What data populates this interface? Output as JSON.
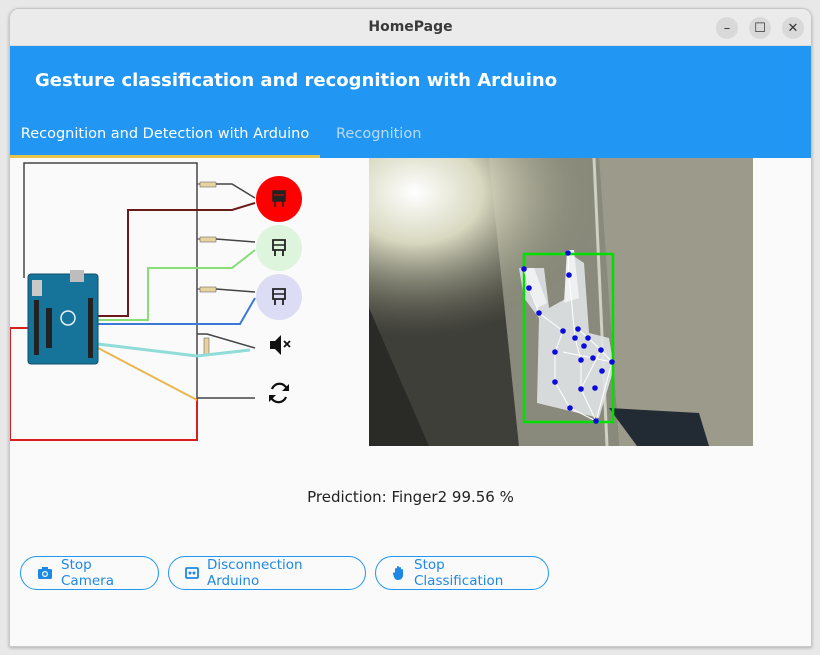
{
  "window": {
    "title": "HomePage",
    "controls": {
      "minimize": "–",
      "maximize": "☐",
      "close": "✕"
    }
  },
  "appbar": {
    "title": "Gesture classification and recognition with Arduino"
  },
  "tabs": [
    {
      "label": "Recognition and Detection with Arduino",
      "active": true
    },
    {
      "label": "Recognition",
      "active": false
    }
  ],
  "circuit": {
    "outputs": [
      {
        "name": "led-red",
        "color": "#ff0000",
        "state": "on"
      },
      {
        "name": "led-green",
        "color": "#dcf5dc",
        "state": "off"
      },
      {
        "name": "led-blue",
        "color": "#dcdcf5",
        "state": "off"
      },
      {
        "name": "buzzer",
        "icon": "volume-mute-icon"
      },
      {
        "name": "servo",
        "icon": "sync-icon"
      }
    ]
  },
  "prediction": {
    "text": "Prediction: Finger2 99.56 %"
  },
  "buttons": [
    {
      "label": "Stop Camera",
      "icon": "camera-icon"
    },
    {
      "label": "Disconnection Arduino",
      "icon": "arduino-board-icon"
    },
    {
      "label": "Stop Classification",
      "icon": "hand-icon"
    }
  ],
  "colors": {
    "accent": "#2196f3",
    "tab_indicator": "#e6c34a",
    "bbox": "#00e000",
    "landmark": "#0a0adc"
  }
}
